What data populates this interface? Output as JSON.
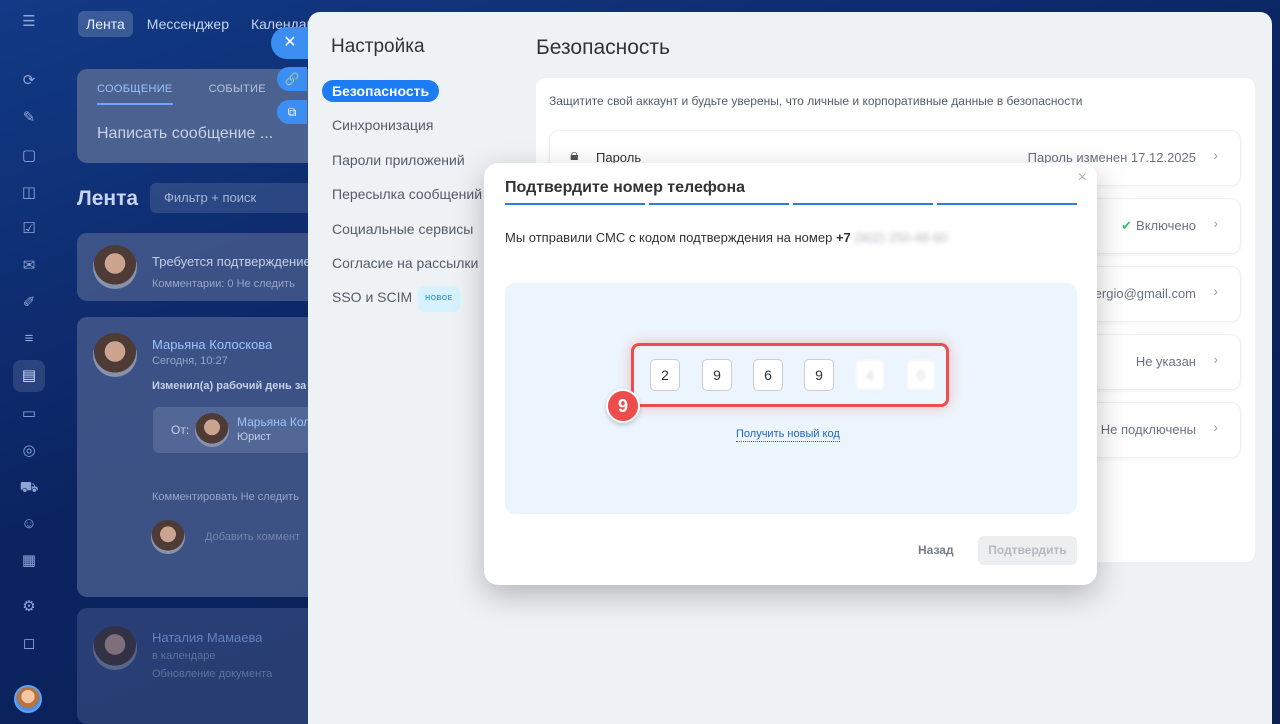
{
  "topnav": {
    "items": [
      "Лента",
      "Мессенджер",
      "Календарь"
    ]
  },
  "feed": {
    "composer_tabs": [
      "СООБЩЕНИЕ",
      "СОБЫТИЕ"
    ],
    "composer_placeholder": "Написать сообщение ...",
    "title": "Лента",
    "search_placeholder": "Фильтр + поиск",
    "post1": {
      "title": "Требуется подтверждение",
      "meta": "Комментарии: 0    Не следить"
    },
    "post2": {
      "author": "Марьяна Колоскова",
      "time": "Сегодня, 10:27",
      "text": "Изменил(а) рабочий день за",
      "from_label": "От:",
      "from_name": "Марьяна Кол",
      "from_role": "Юрист",
      "actions": "Комментировать    Не следить",
      "comment_placeholder": "Добавить коммент"
    },
    "post3": {
      "author": "Наталия Мамаева",
      "line2": "в календаре",
      "line3": "Обновление документа"
    }
  },
  "settings": {
    "title": "Настройка",
    "nav": [
      "Безопасность",
      "Синхронизация",
      "Пароли приложений",
      "Пересылка сообщений",
      "Социальные сервисы",
      "Согласие на рассылки",
      "SSO и SCIM"
    ],
    "new_badge": "НОВОЕ"
  },
  "security": {
    "title": "Безопасность",
    "description": "Защитите свой аккаунт и будьте уверены, что личные и корпоративные данные в безопасности",
    "rows": [
      {
        "label": "Пароль",
        "value": "Пароль изменен 17.12.2025"
      },
      {
        "label": "",
        "value": "Включено"
      },
      {
        "label": "",
        "value": "ergio@gmail.com"
      },
      {
        "label": "",
        "value": "Не указан"
      },
      {
        "label": "",
        "value": "Не подключены"
      }
    ]
  },
  "modal": {
    "title": "Подтвердите номер телефона",
    "close": "×",
    "sms_text": "Мы отправили СМС с кодом подтверждения на номер",
    "phone_prefix": "+7",
    "phone_hidden": "(902) 250-48-60",
    "code_digits": [
      "2",
      "9",
      "6",
      "9",
      "4",
      "0"
    ],
    "step_number": "9",
    "resend_link": "Получить новый код",
    "back_button": "Назад",
    "confirm_button": "Подтвердить"
  },
  "colors": {
    "accent": "#1b7cf4",
    "highlight": "#ee4d4d",
    "success": "#2fc26e"
  }
}
